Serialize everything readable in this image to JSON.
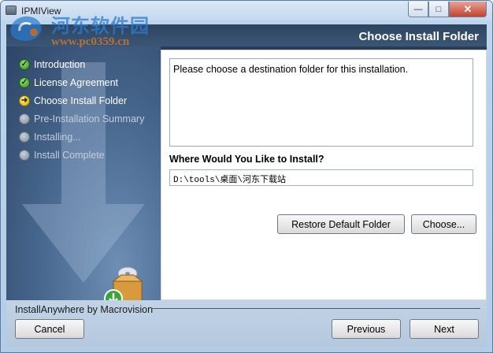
{
  "window": {
    "title": "IPMIView",
    "watermark_cn": "河东软件园",
    "watermark_url": "www.pc0359.cn",
    "minimize_glyph": "—",
    "maximize_glyph": "□",
    "close_glyph": "✕"
  },
  "header": {
    "title": "Choose Install Folder"
  },
  "steps": [
    {
      "label": "Introduction",
      "state": "done",
      "glyph": "✓"
    },
    {
      "label": "License Agreement",
      "state": "done",
      "glyph": "✓"
    },
    {
      "label": "Choose Install Folder",
      "state": "current",
      "glyph": "➜"
    },
    {
      "label": "Pre-Installation Summary",
      "state": "pending",
      "glyph": ""
    },
    {
      "label": "Installing...",
      "state": "pending",
      "glyph": ""
    },
    {
      "label": "Install Complete",
      "state": "pending",
      "glyph": ""
    }
  ],
  "content": {
    "description": "Please choose a destination folder for this installation.",
    "location_label": "Where Would You Like to Install?",
    "install_path": "D:\\tools\\桌面\\河东下载站",
    "restore_button": "Restore Default Folder",
    "choose_button": "Choose..."
  },
  "footer": {
    "brand_label": "InstallAnywhere by Macrovision",
    "cancel_button": "Cancel",
    "previous_button": "Previous",
    "next_button": "Next"
  },
  "colors": {
    "header_bg": "#2e4560",
    "sidebar_bg": "#4a6a92",
    "done": "#2f8a1a",
    "current": "#d4a800",
    "pending": "#7c8a98"
  }
}
